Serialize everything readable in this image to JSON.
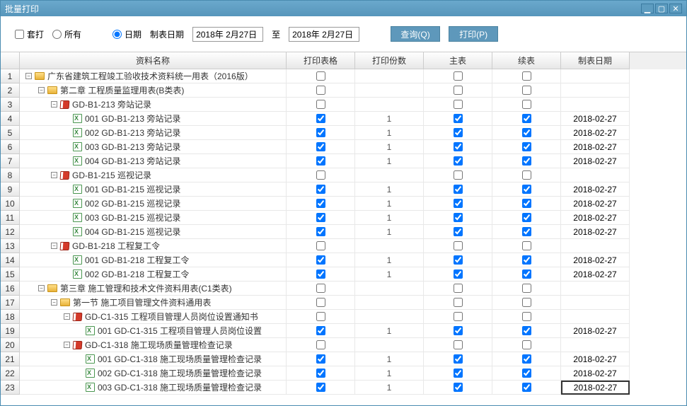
{
  "window": {
    "title": "批量打印"
  },
  "toolbar": {
    "taoda": "套打",
    "all": "所有",
    "date_opt": "日期",
    "date_label": "制表日期",
    "date_a": "2018年 2月27日",
    "to": "至",
    "date_b": "2018年 2月27日",
    "query": "查询(Q)",
    "print": "打印(P)"
  },
  "cols": {
    "name": "资料名称",
    "pfmt": "打印表格",
    "qty": "打印份数",
    "main": "主表",
    "ext": "续表",
    "date": "制表日期"
  },
  "rows": [
    {
      "n": "1",
      "indent": 0,
      "toggle": "−",
      "icon": "folder",
      "label": "广东省建筑工程竣工验收技术资料统一用表（2016版）",
      "chk": "off",
      "qty": "",
      "main": "off",
      "ext": "off",
      "date": ""
    },
    {
      "n": "2",
      "indent": 1,
      "toggle": "−",
      "icon": "folder",
      "label": "第二章  工程质量监理用表(B类表)",
      "chk": "off",
      "qty": "",
      "main": "off",
      "ext": "off",
      "date": ""
    },
    {
      "n": "3",
      "indent": 2,
      "toggle": "−",
      "icon": "book",
      "label": "GD-B1-213 旁站记录",
      "chk": "off",
      "qty": "",
      "main": "off",
      "ext": "off",
      "date": ""
    },
    {
      "n": "4",
      "indent": 3,
      "toggle": "",
      "icon": "xls",
      "label": "001 GD-B1-213 旁站记录",
      "chk": "on",
      "qty": "1",
      "main": "on",
      "ext": "on",
      "date": "2018-02-27"
    },
    {
      "n": "5",
      "indent": 3,
      "toggle": "",
      "icon": "xls",
      "label": "002 GD-B1-213 旁站记录",
      "chk": "on",
      "qty": "1",
      "main": "on",
      "ext": "on",
      "date": "2018-02-27"
    },
    {
      "n": "6",
      "indent": 3,
      "toggle": "",
      "icon": "xls",
      "label": "003 GD-B1-213 旁站记录",
      "chk": "on",
      "qty": "1",
      "main": "on",
      "ext": "on",
      "date": "2018-02-27"
    },
    {
      "n": "7",
      "indent": 3,
      "toggle": "",
      "icon": "xls",
      "label": "004 GD-B1-213 旁站记录",
      "chk": "on",
      "qty": "1",
      "main": "on",
      "ext": "on",
      "date": "2018-02-27"
    },
    {
      "n": "8",
      "indent": 2,
      "toggle": "−",
      "icon": "book",
      "label": "GD-B1-215 巡视记录",
      "chk": "off",
      "qty": "",
      "main": "off",
      "ext": "off",
      "date": ""
    },
    {
      "n": "9",
      "indent": 3,
      "toggle": "",
      "icon": "xls",
      "label": "001 GD-B1-215 巡视记录",
      "chk": "on",
      "qty": "1",
      "main": "on",
      "ext": "on",
      "date": "2018-02-27"
    },
    {
      "n": "10",
      "indent": 3,
      "toggle": "",
      "icon": "xls",
      "label": "002 GD-B1-215 巡视记录",
      "chk": "on",
      "qty": "1",
      "main": "on",
      "ext": "on",
      "date": "2018-02-27"
    },
    {
      "n": "11",
      "indent": 3,
      "toggle": "",
      "icon": "xls",
      "label": "003 GD-B1-215 巡视记录",
      "chk": "on",
      "qty": "1",
      "main": "on",
      "ext": "on",
      "date": "2018-02-27"
    },
    {
      "n": "12",
      "indent": 3,
      "toggle": "",
      "icon": "xls",
      "label": "004 GD-B1-215 巡视记录",
      "chk": "on",
      "qty": "1",
      "main": "on",
      "ext": "on",
      "date": "2018-02-27"
    },
    {
      "n": "13",
      "indent": 2,
      "toggle": "−",
      "icon": "book",
      "label": "GD-B1-218 工程复工令",
      "chk": "off",
      "qty": "",
      "main": "off",
      "ext": "off",
      "date": ""
    },
    {
      "n": "14",
      "indent": 3,
      "toggle": "",
      "icon": "xls",
      "label": "001 GD-B1-218 工程复工令",
      "chk": "on",
      "qty": "1",
      "main": "on",
      "ext": "on",
      "date": "2018-02-27"
    },
    {
      "n": "15",
      "indent": 3,
      "toggle": "",
      "icon": "xls",
      "label": "002 GD-B1-218 工程复工令",
      "chk": "on",
      "qty": "1",
      "main": "on",
      "ext": "on",
      "date": "2018-02-27"
    },
    {
      "n": "16",
      "indent": 1,
      "toggle": "−",
      "icon": "folder",
      "label": "第三章  施工管理和技术文件资料用表(C1类表)",
      "chk": "off",
      "qty": "",
      "main": "off",
      "ext": "off",
      "date": ""
    },
    {
      "n": "17",
      "indent": 2,
      "toggle": "−",
      "icon": "folder",
      "label": "第一节 施工项目管理文件资料通用表",
      "chk": "off",
      "qty": "",
      "main": "off",
      "ext": "off",
      "date": ""
    },
    {
      "n": "18",
      "indent": 3,
      "toggle": "−",
      "icon": "book",
      "label": "GD-C1-315 工程项目管理人员岗位设置通知书",
      "chk": "off",
      "qty": "",
      "main": "off",
      "ext": "off",
      "date": ""
    },
    {
      "n": "19",
      "indent": 4,
      "toggle": "",
      "icon": "xls",
      "label": "001 GD-C1-315 工程项目管理人员岗位设置",
      "chk": "on",
      "qty": "1",
      "main": "on",
      "ext": "on",
      "date": "2018-02-27"
    },
    {
      "n": "20",
      "indent": 3,
      "toggle": "−",
      "icon": "book",
      "label": "GD-C1-318 施工现场质量管理检查记录",
      "chk": "off",
      "qty": "",
      "main": "off",
      "ext": "off",
      "date": ""
    },
    {
      "n": "21",
      "indent": 4,
      "toggle": "",
      "icon": "xls",
      "label": "001 GD-C1-318 施工现场质量管理检查记录",
      "chk": "on",
      "qty": "1",
      "main": "on",
      "ext": "on",
      "date": "2018-02-27"
    },
    {
      "n": "22",
      "indent": 4,
      "toggle": "",
      "icon": "xls",
      "label": "002 GD-C1-318 施工现场质量管理检查记录",
      "chk": "on",
      "qty": "1",
      "main": "on",
      "ext": "on",
      "date": "2018-02-27"
    },
    {
      "n": "23",
      "indent": 4,
      "toggle": "",
      "icon": "xls",
      "label": "003 GD-C1-318 施工现场质量管理检查记录",
      "chk": "on",
      "qty": "1",
      "main": "on",
      "ext": "on",
      "date": "2018-02-27",
      "sel": true
    }
  ]
}
